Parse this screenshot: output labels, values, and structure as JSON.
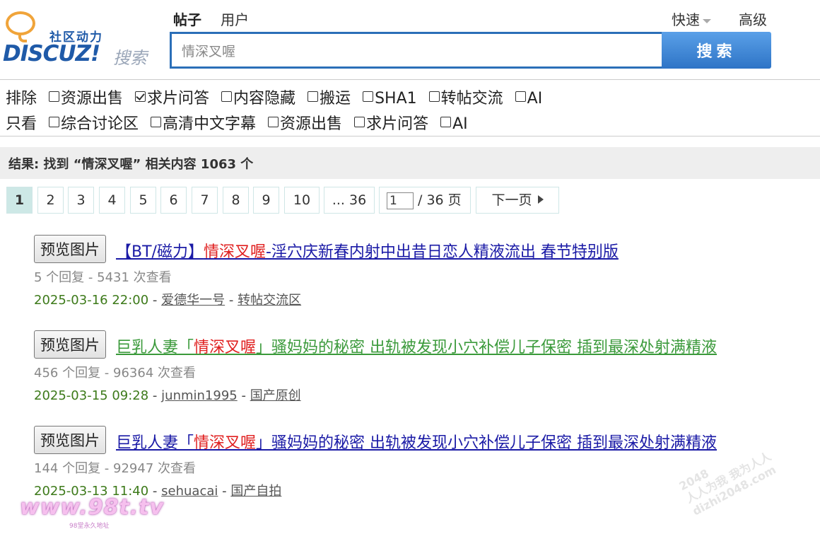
{
  "logo": {
    "cn": "社区动力",
    "en": "DISCUZ!",
    "search": "搜索"
  },
  "tabs": [
    {
      "label": "帖子",
      "active": true
    },
    {
      "label": "用户",
      "active": false
    }
  ],
  "quick_label": "快速",
  "advanced_label": "高级",
  "search": {
    "value": "情深叉喔",
    "button": "搜索"
  },
  "filters": {
    "exclude_label": "排除",
    "exclude": [
      {
        "label": "资源出售",
        "checked": false
      },
      {
        "label": "求片问答",
        "checked": true
      },
      {
        "label": "内容隐藏",
        "checked": false
      },
      {
        "label": "搬运",
        "checked": false
      },
      {
        "label": "SHA1",
        "checked": false
      },
      {
        "label": "转帖交流",
        "checked": false
      },
      {
        "label": "AI",
        "checked": false
      }
    ],
    "only_label": "只看",
    "only": [
      {
        "label": "综合讨论区",
        "checked": false
      },
      {
        "label": "高清中文字幕",
        "checked": false
      },
      {
        "label": "资源出售",
        "checked": false
      },
      {
        "label": "求片问答",
        "checked": false
      },
      {
        "label": "AI",
        "checked": false
      }
    ]
  },
  "result_summary": "结果: 找到 “情深叉喔” 相关内容 1063 个",
  "pager": {
    "pages": [
      "1",
      "2",
      "3",
      "4",
      "5",
      "6",
      "7",
      "8",
      "9",
      "10",
      "... 36"
    ],
    "current": "1",
    "jump_value": "1",
    "jump_total": "/ 36 页",
    "next": "下一页"
  },
  "results": [
    {
      "preview": "预览图片",
      "title_pre": "【BT/磁力】",
      "title_hl": "情深叉喔",
      "title_post": "-淫穴庆新春内射中出昔日恋人精液流出 春节特别版",
      "color": "blue",
      "stats": "5 个回复 - 5431 次查看",
      "date": "2025-03-16 22:00",
      "author": "爱德华一号",
      "forum": "转帖交流区"
    },
    {
      "preview": "预览图片",
      "title_pre": "巨乳人妻「",
      "title_hl": "情深叉喔",
      "title_post": "」骚妈妈的秘密 出轨被发现小穴补偿儿子保密 插到最深处射满精液",
      "color": "green",
      "stats": "456 个回复 - 96364 次查看",
      "date": "2025-03-15 09:28",
      "author": "junmin1995",
      "forum": "国产原创"
    },
    {
      "preview": "预览图片",
      "title_pre": "巨乳人妻「",
      "title_hl": "情深叉喔",
      "title_post": "」骚妈妈的秘密 出轨被发现小穴补偿儿子保密 插到最深处射满精液",
      "color": "blue",
      "stats": "144 个回复 - 92947 次查看",
      "date": "2025-03-13 11:40",
      "author": "sehuacai",
      "forum": "国产自拍"
    }
  ],
  "watermarks": {
    "w98": "www.98t.tv",
    "w98_sub": "98堂永久地址",
    "w2048_a": "2048",
    "w2048_b": "人人为我 我为人人",
    "w2048_c": "dizhi2048.com"
  }
}
